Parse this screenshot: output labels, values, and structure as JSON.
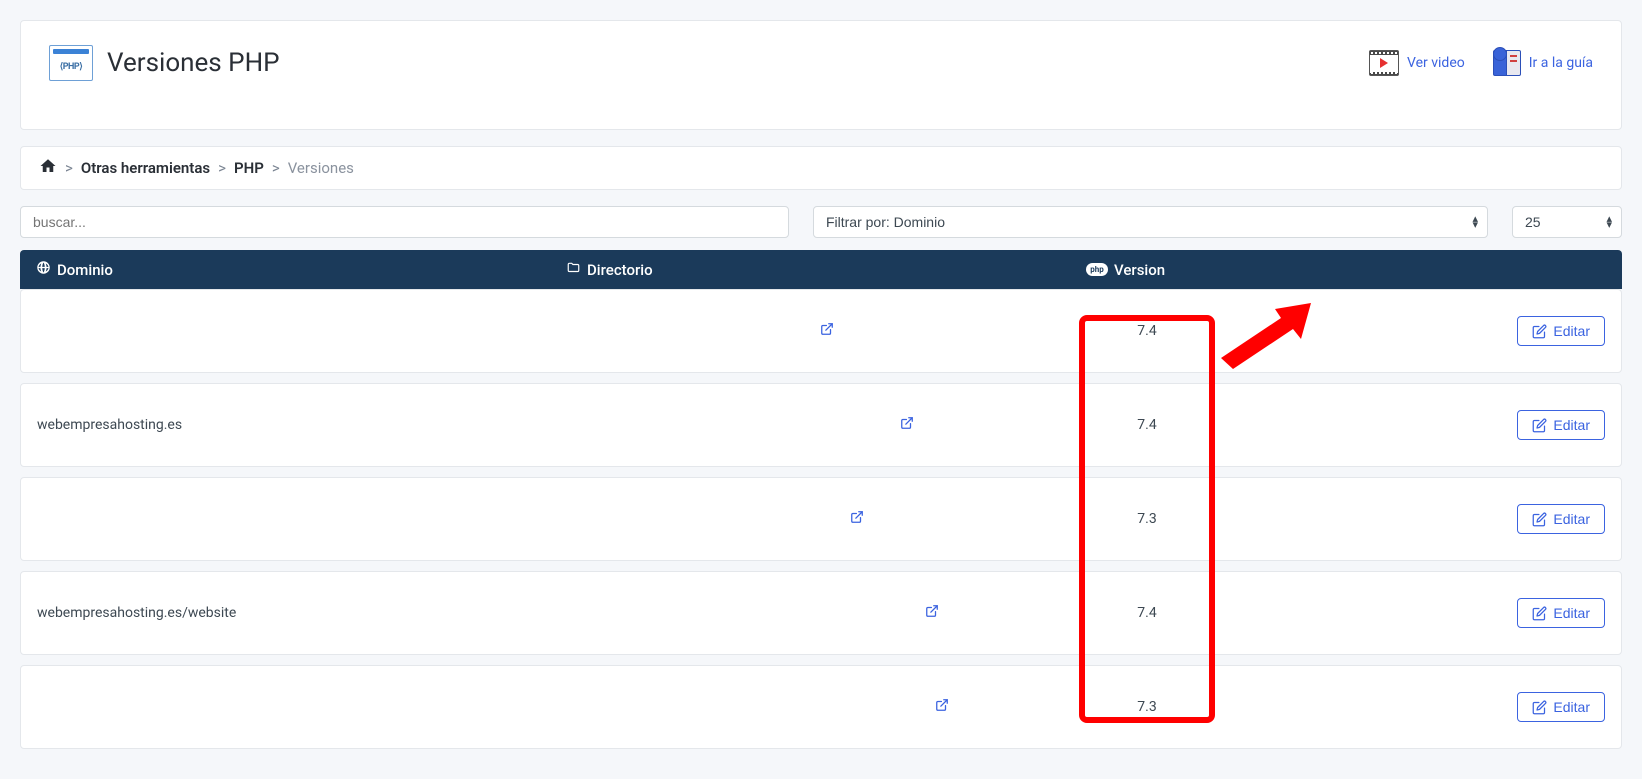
{
  "header": {
    "title": "Versiones PHP",
    "logo_label": "⟨PHP⟩",
    "video_link": "Ver video",
    "guide_link": "Ir a la guía"
  },
  "breadcrumb": {
    "items": [
      "Otras herramientas",
      "PHP"
    ],
    "current": "Versiones"
  },
  "controls": {
    "search_placeholder": "buscar...",
    "filter_label": "Filtrar por: Dominio",
    "page_size": "25"
  },
  "table": {
    "columns": {
      "domain": "Dominio",
      "directory": "Directorio",
      "version": "Version"
    },
    "edit_label": "Editar",
    "rows": [
      {
        "domain": "",
        "version": "7.4",
        "dir_shift": ""
      },
      {
        "domain": "webempresahosting.es",
        "version": "7.4",
        "dir_shift": "shift-1"
      },
      {
        "domain": "",
        "version": "7.3",
        "dir_shift": "shift-2"
      },
      {
        "domain": "webempresahosting.es/website",
        "version": "7.4",
        "dir_shift": "shift-3"
      },
      {
        "domain": "",
        "version": "7.3",
        "dir_shift": "shift-4"
      }
    ]
  }
}
